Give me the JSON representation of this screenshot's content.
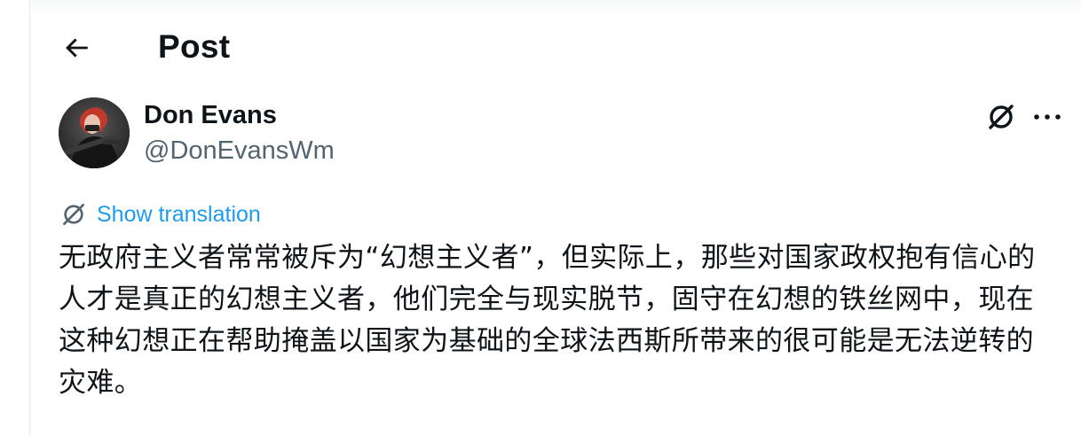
{
  "header": {
    "back_icon": "arrow-left-icon",
    "title": "Post"
  },
  "author": {
    "display_name": "Don Evans",
    "handle": "@DonEvansWm",
    "avatar_icon": "avatar"
  },
  "actions": {
    "grok_icon": "grok-icon",
    "more_icon": "more-horizontal-icon"
  },
  "translation": {
    "icon": "grok-translate-icon",
    "label": "Show translation"
  },
  "post": {
    "text": "无政府主义者常常被斥为“幻想主义者”，但实际上，那些对国家政权抱有信心的人才是真正的幻想主义者，他们完全与现实脱节，固守在幻想的铁丝网中，现在这种幻想正在帮助掩盖以国家为基础的全球法西斯所带来的很可能是无法逆转的灾难。"
  },
  "colors": {
    "text": "#0f1419",
    "secondary": "#536471",
    "link": "#1d9bf0",
    "border": "#e7e9ea"
  }
}
